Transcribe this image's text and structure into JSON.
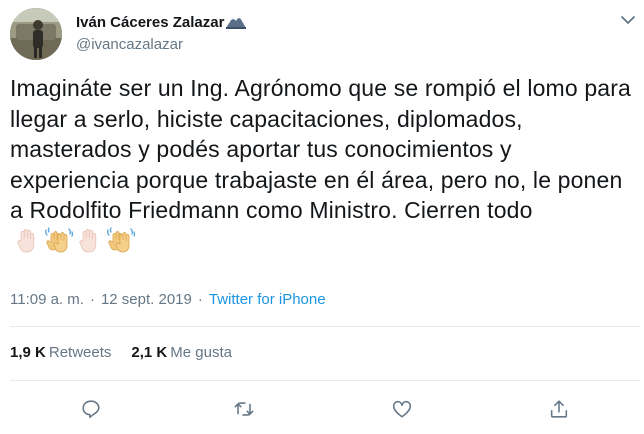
{
  "author": {
    "display_name": "Iván Cáceres Zalazar",
    "handle": "@ivancazalazar",
    "avatar_icon": "user-avatar-photo",
    "name_emoji": "mountain-eagle-emoji"
  },
  "tweet": {
    "text": "Imagináte ser un Ing. Agrónomo que se rompió el lomo para llegar a serlo, hiciste capacitaciones, diplomados, masterados y podés aportar tus conocimientos y experiencia porque trabajaste en él área, pero no, le ponen a Rodolfito Friedmann como Ministro. Cierren todo",
    "emojis": [
      "raised-hand-emoji",
      "waving-hands-emoji",
      "raised-hand-emoji",
      "waving-hands-emoji"
    ]
  },
  "meta": {
    "time": "11:09 a. m.",
    "separator": "·",
    "date": "12 sept. 2019",
    "source": "Twitter for iPhone"
  },
  "stats": {
    "retweets_count": "1,9 K",
    "retweets_label": "Retweets",
    "likes_count": "2,1 K",
    "likes_label": "Me gusta"
  },
  "actions": {
    "reply_icon": "reply-icon",
    "retweet_icon": "retweet-icon",
    "like_icon": "heart-icon",
    "share_icon": "share-icon"
  },
  "colors": {
    "text": "#14171a",
    "secondary": "#657786",
    "link": "#1b95e0",
    "divider": "#e6ecf0"
  }
}
